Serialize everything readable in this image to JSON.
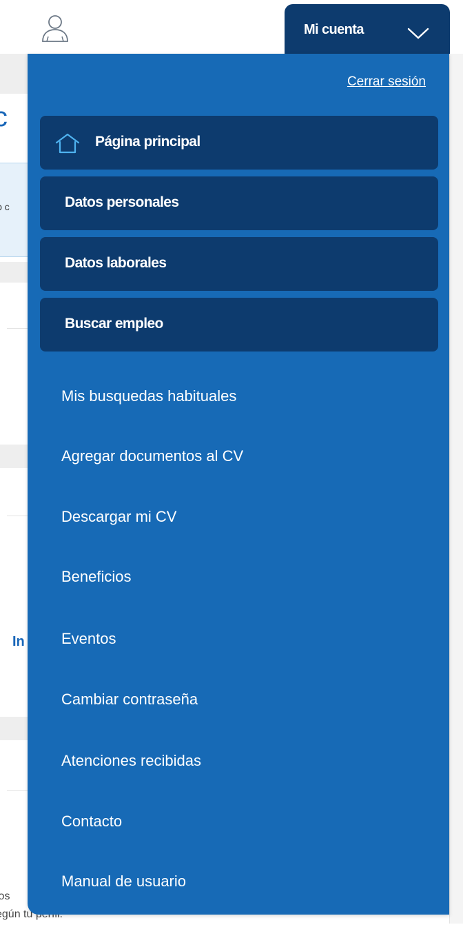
{
  "background": {
    "title_fragment": "ic",
    "info_fragment": "jo c",
    "heading_fragment": "In",
    "text_line1": "ios",
    "text_line2": "egún tu perfil."
  },
  "header": {
    "user_icon": "user-icon",
    "account_label": "Mi cuenta",
    "chevron_icon": "chevron-down-icon"
  },
  "menu": {
    "logout_label": "Cerrar sesión",
    "main_items": [
      {
        "label": "Página principal",
        "icon": "home-icon"
      },
      {
        "label": "Datos personales"
      },
      {
        "label": "Datos laborales"
      },
      {
        "label": "Buscar empleo"
      }
    ],
    "sub_items": [
      {
        "label": "Mis busquedas habituales"
      },
      {
        "label": "Agregar documentos al CV"
      },
      {
        "label": "Descargar mi CV"
      },
      {
        "label": "Beneficios"
      },
      {
        "label": "Eventos"
      },
      {
        "label": "Cambiar contraseña"
      },
      {
        "label": "Atenciones recibidas"
      },
      {
        "label": "Contacto"
      },
      {
        "label": "Manual de usuario"
      }
    ]
  },
  "colors": {
    "panel": "#176ab6",
    "main_item": "#0d3b6e",
    "text": "#ffffff"
  }
}
